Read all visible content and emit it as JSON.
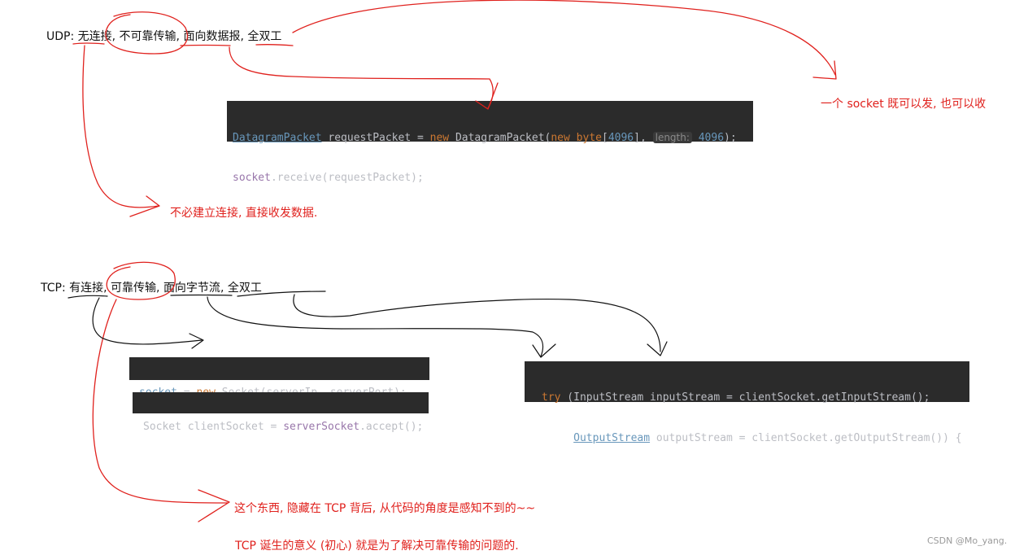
{
  "udp": {
    "label": "UDP:",
    "t1": "无连接",
    "s1": ",",
    "t2": "不可靠传输",
    "s2": ",",
    "t3": "面向数据报",
    "s3": ",",
    "t4": "全双工"
  },
  "udp_code": {
    "l1_class": "DatagramPacket",
    "l1_a": " requestPacket = ",
    "l1_new": "new",
    "l1_b": " DatagramPacket(",
    "l1_new2": "new",
    "l1_space": " ",
    "l1_byte": "byte",
    "l1_c": "[",
    "l1_n1": "4096",
    "l1_d": "], ",
    "l1_hint": "length:",
    "l1_space2": " ",
    "l1_n2": "4096",
    "l1_e": ");",
    "l2_field": "socket",
    "l2_a": ".receive(requestPacket);"
  },
  "udp_notes": {
    "full_duplex": "一个 socket 既可以发, 也可以收",
    "no_connection": "不必建立连接, 直接收发数据."
  },
  "tcp": {
    "label": "TCP:",
    "t1": "有连接",
    "s1": ",",
    "t2": "可靠传输",
    "s2": ",",
    "t3": "面向字节流",
    "s3": ",",
    "t4": "全双工"
  },
  "tcp_code_a": {
    "field": "socket",
    "a": " = ",
    "new": "new",
    "b": " Socket(serverIp, serverPort);"
  },
  "tcp_code_b": {
    "a": "Socket clientSocket = ",
    "field": "serverSocket",
    "b": ".accept();"
  },
  "tcp_code_c": {
    "l1_try": "try",
    "l1_a": " (InputStream inputStream = clientSocket.getInputStream();",
    "l2_indent": "     ",
    "l2_class": "OutputStream",
    "l2_a": " outputStream = clientSocket.getOutputStream()) {"
  },
  "tcp_notes": {
    "hidden": "这个东西, 隐藏在 TCP 背后, 从代码的角度是感知不到的~~",
    "purpose": "TCP 诞生的意义 (初心) 就是为了解决可靠传输的问题的."
  },
  "watermark": "CSDN @Mo_yang.",
  "colors": {
    "annotation": "#e0211d",
    "code_bg": "#2b2b2b",
    "keyword": "#cc7832",
    "number": "#6897bb",
    "field": "#9876aa"
  }
}
